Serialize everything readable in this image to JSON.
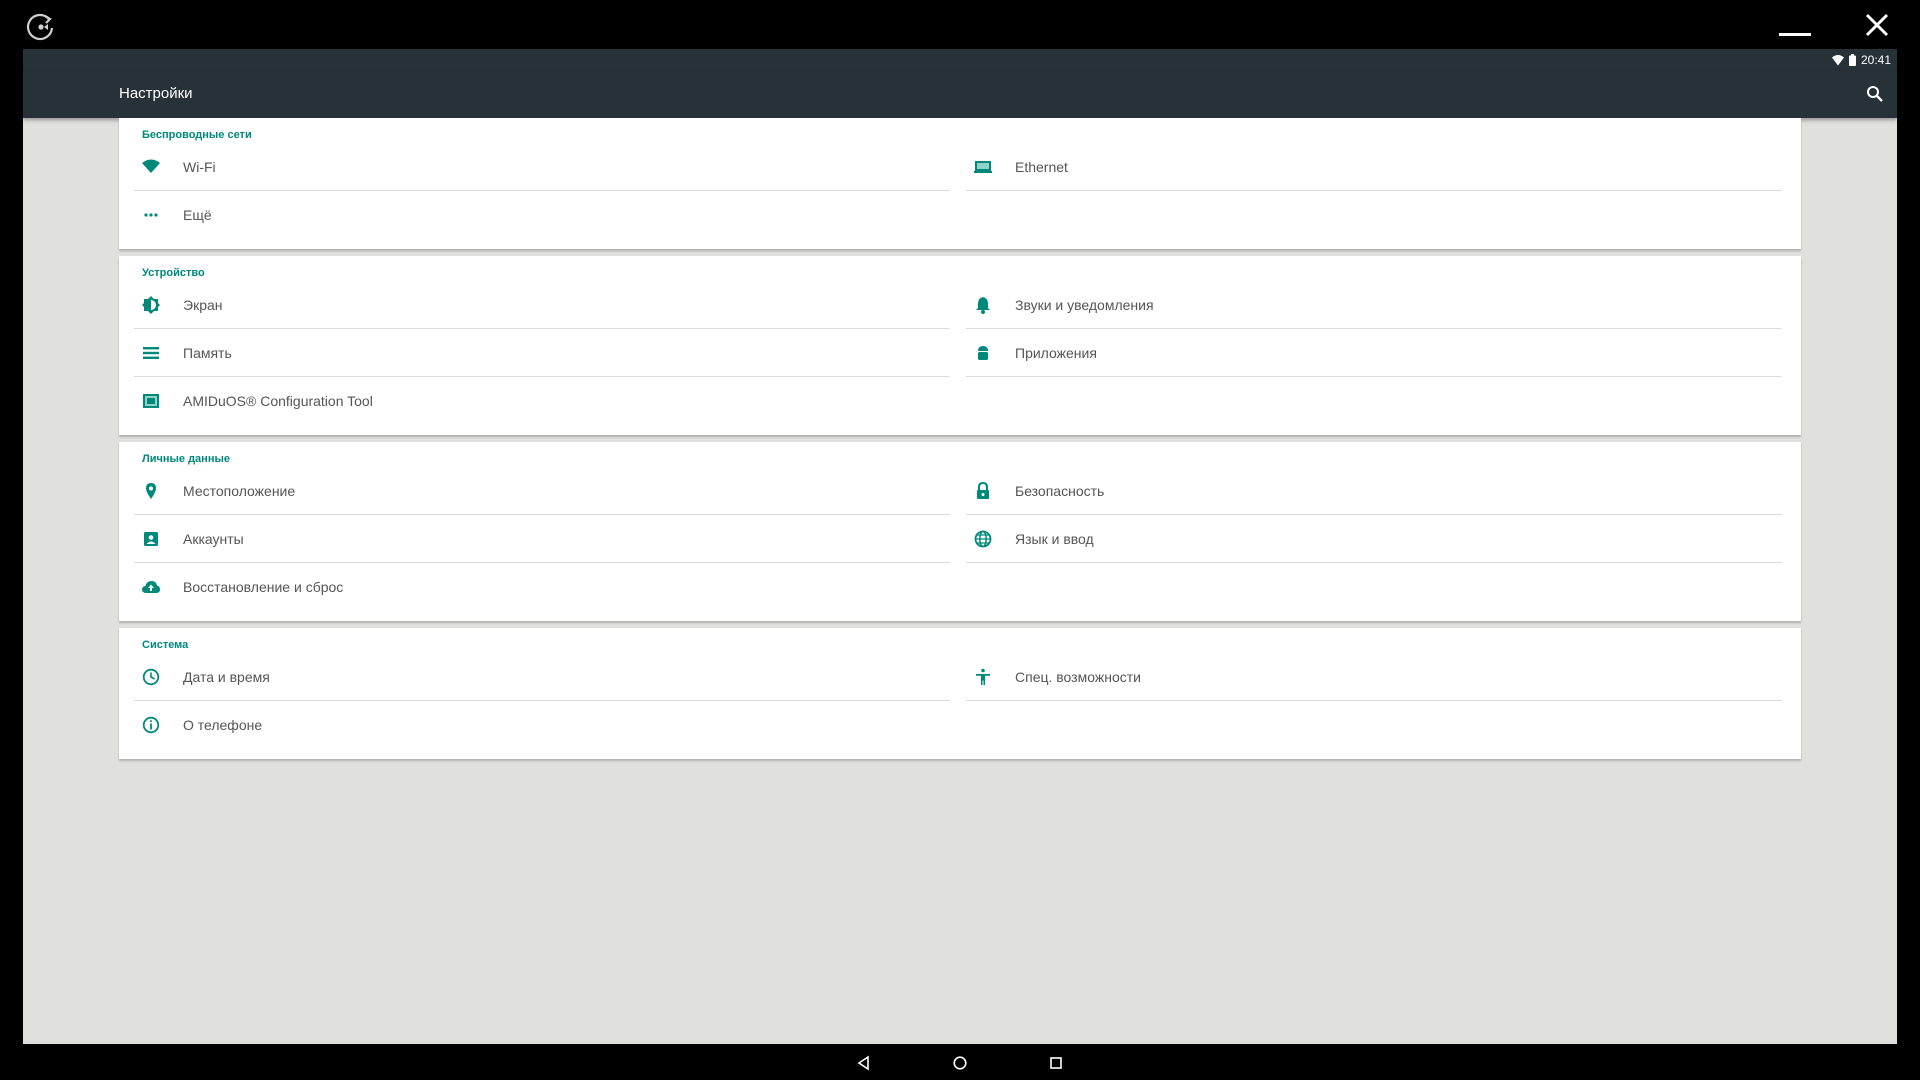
{
  "emulator": {
    "rotate_icon": "rotate-icon",
    "minimize_icon": "minimize-icon",
    "close_icon": "close-icon"
  },
  "status_bar": {
    "time": "20:41",
    "icons": [
      "wifi-icon",
      "battery-icon"
    ]
  },
  "app_bar": {
    "title": "Настройки",
    "search_icon": "search-icon"
  },
  "colors": {
    "accent": "#00897b",
    "app_bar": "#263238",
    "background": "#e0e0df"
  },
  "sections": [
    {
      "title": "Беспроводные сети",
      "items": [
        {
          "label": "Wi-Fi",
          "icon": "wifi-icon"
        },
        {
          "label": "Ethernet",
          "icon": "ethernet-icon"
        },
        {
          "label": "Ещё",
          "icon": "more-icon"
        }
      ]
    },
    {
      "title": "Устройство",
      "items": [
        {
          "label": "Экран",
          "icon": "brightness-icon"
        },
        {
          "label": "Звуки и уведомления",
          "icon": "bell-icon"
        },
        {
          "label": "Память",
          "icon": "storage-icon"
        },
        {
          "label": "Приложения",
          "icon": "android-icon"
        },
        {
          "label": "AMIDuOS® Configuration Tool",
          "icon": "config-tool-icon"
        }
      ]
    },
    {
      "title": "Личные данные",
      "items": [
        {
          "label": "Местоположение",
          "icon": "location-icon"
        },
        {
          "label": "Безопасность",
          "icon": "lock-icon"
        },
        {
          "label": "Аккаунты",
          "icon": "account-icon"
        },
        {
          "label": "Язык и ввод",
          "icon": "globe-icon"
        },
        {
          "label": "Восстановление и сброс",
          "icon": "cloud-upload-icon"
        }
      ]
    },
    {
      "title": "Система",
      "items": [
        {
          "label": "Дата и время",
          "icon": "clock-icon"
        },
        {
          "label": "Спец. возможности",
          "icon": "accessibility-icon"
        },
        {
          "label": "О телефоне",
          "icon": "info-icon"
        }
      ]
    }
  ],
  "nav_bar": {
    "icons": [
      "back-icon",
      "home-icon",
      "recents-icon"
    ]
  }
}
